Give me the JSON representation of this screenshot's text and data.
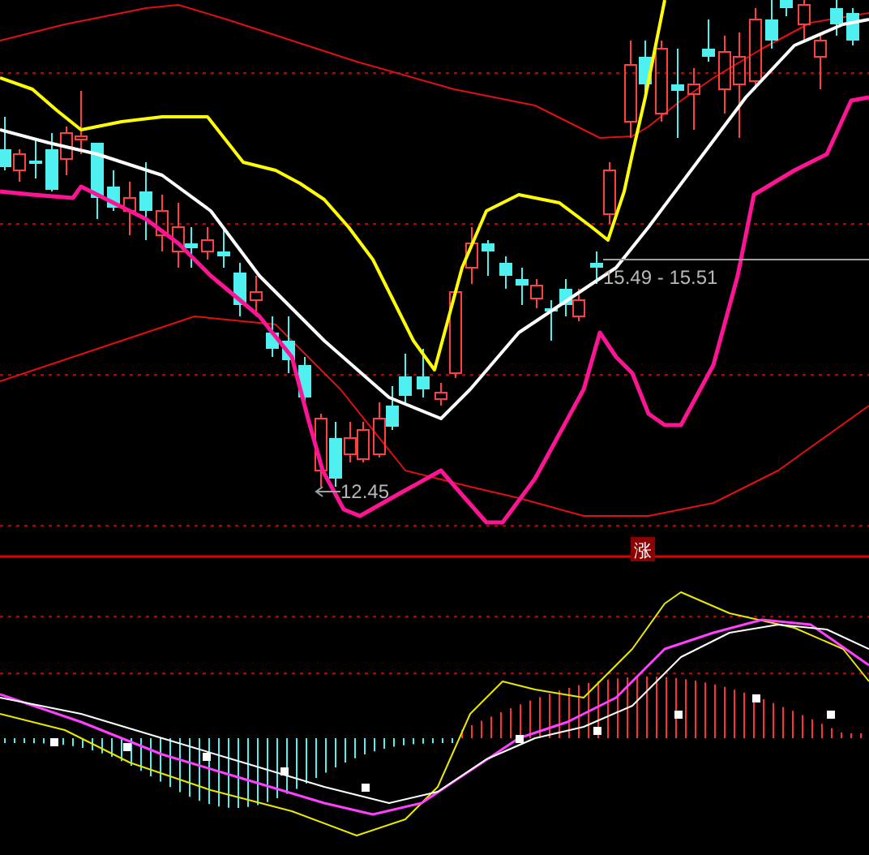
{
  "price_chart": {
    "high_label": "15.49 - 15.51",
    "low_label": "12.45"
  },
  "badge": {
    "text": "涨"
  }
}
